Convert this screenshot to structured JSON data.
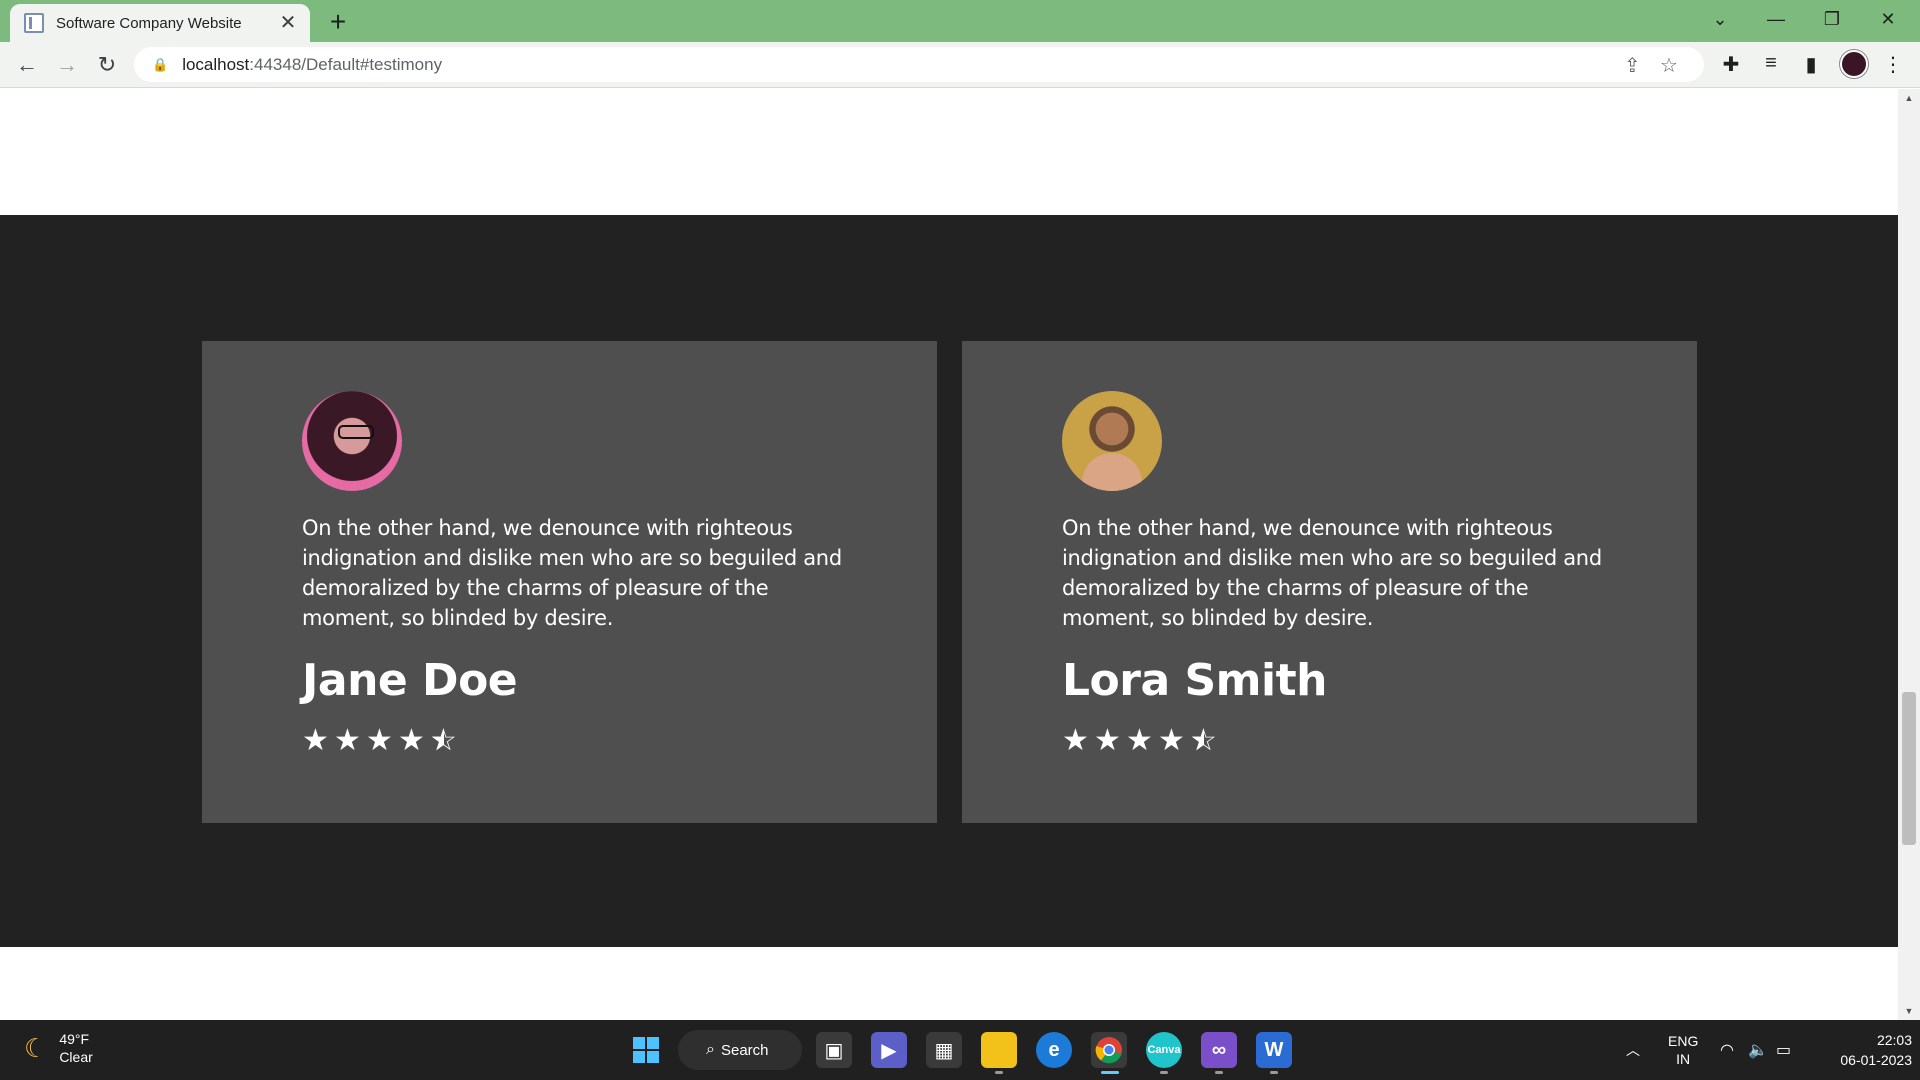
{
  "browser": {
    "tab_title": "Software Company Website",
    "url_host": "localhost",
    "url_rest": ":44348/Default#testimony"
  },
  "testimonials": [
    {
      "quote": "On the other hand, we denounce with righteous indignation and dislike men who are so beguiled and demoralized by the charms of pleasure of the moment, so blinded by desire.",
      "name": "Jane Doe",
      "rating": 4.5
    },
    {
      "quote": "On the other hand, we denounce with righteous indignation and dislike men who are so beguiled and demoralized by the charms of pleasure of the moment, so blinded by desire.",
      "name": "Lora Smith",
      "rating": 4.5
    }
  ],
  "taskbar": {
    "weather_temp": "49°F",
    "weather_desc": "Clear",
    "search_label": "Search",
    "lang_top": "ENG",
    "lang_bottom": "IN",
    "time": "22:03",
    "date": "06-01-2023"
  },
  "colors": {
    "tabbar": "#7dba7d",
    "section_bg": "#222222",
    "card_bg": "#4f4f4f"
  }
}
